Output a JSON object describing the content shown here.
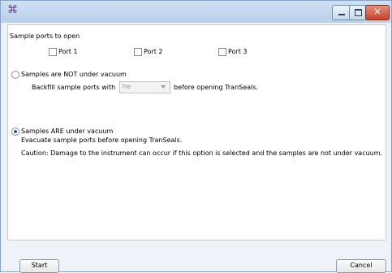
{
  "titlebar": {
    "icon": "app-icon",
    "title": ""
  },
  "ports": {
    "heading": "Sample ports to open",
    "items": [
      {
        "label": "Port 1",
        "checked": false
      },
      {
        "label": "Port 2",
        "checked": false
      },
      {
        "label": "Port 3",
        "checked": false
      }
    ]
  },
  "not_vacuum": {
    "label": "Samples are NOT under vacuum",
    "selected": false,
    "backfill_prefix": "Backfill sample ports with",
    "backfill_value": "he",
    "backfill_suffix": "before opening TranSeals."
  },
  "vacuum": {
    "label": "Samples ARE under vacuum",
    "selected": true,
    "line1": "Evacuate sample ports before opening TranSeals.",
    "line2": "Caution: Damage to the instrument can occur if this option is selected and the samples are not under vacuum."
  },
  "buttons": {
    "start": "Start",
    "cancel": "Cancel"
  },
  "colors": {
    "titlebar": "#c4d7ee",
    "close": "#c5432a",
    "radio_dot": "#2b5aa8"
  }
}
